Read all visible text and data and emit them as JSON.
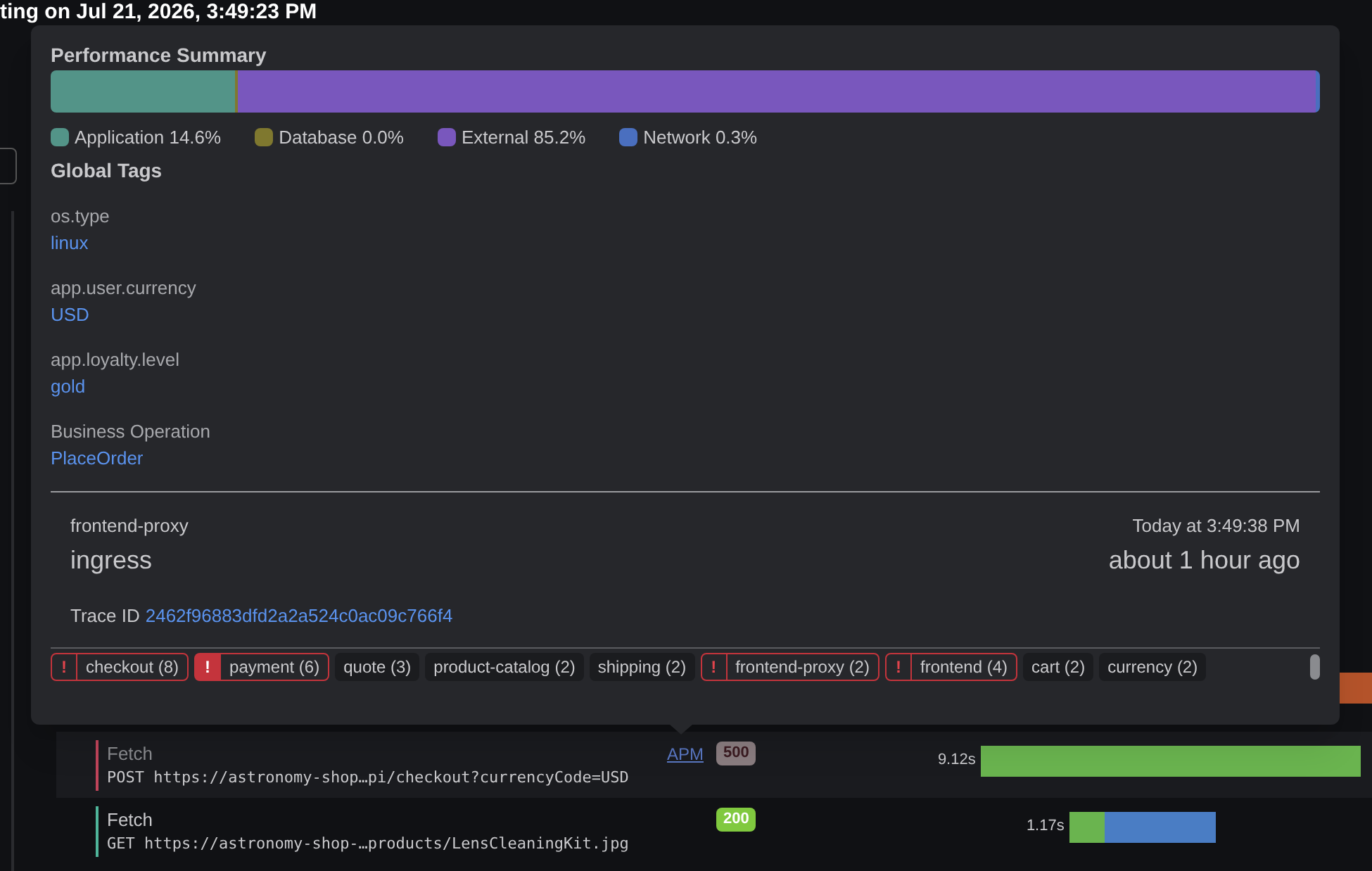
{
  "page_title": "ting on Jul 21, 2026, 3:49:23 PM",
  "popup": {
    "summary_title": "Performance Summary",
    "segments": [
      {
        "label": "Application 14.6%",
        "color": "#539488",
        "level": 0.146
      },
      {
        "label": "Database 0.0%",
        "color": "#7f782f",
        "level": 0.0
      },
      {
        "label": "External 85.2%",
        "color": "#7957bd",
        "level": 0.852
      },
      {
        "label": "Network 0.3%",
        "color": "#4a6fbf",
        "level": 0.003
      }
    ],
    "tags_title": "Global Tags",
    "tags": [
      {
        "key": "os.type",
        "value": "linux"
      },
      {
        "key": "app.user.currency",
        "value": "USD"
      },
      {
        "key": "app.loyalty.level",
        "value": "gold"
      },
      {
        "key": "Business Operation",
        "value": "PlaceOrder"
      }
    ],
    "service": "frontend-proxy",
    "operation": "ingress",
    "time": "Today at 3:49:38 PM",
    "ago": "about 1 hour ago",
    "trace_label": "Trace ID",
    "trace_id": "2462f96883dfd2a2a524c0ac09c766f4",
    "services": [
      {
        "name": "checkout",
        "count": "(8)",
        "kind": "error",
        "icon": "!"
      },
      {
        "name": "payment",
        "count": "(6)",
        "kind": "error_active",
        "icon": "!"
      },
      {
        "name": "quote",
        "count": "(3)",
        "kind": "plain"
      },
      {
        "name": "product-catalog",
        "count": "(2)",
        "kind": "plain"
      },
      {
        "name": "shipping",
        "count": "(2)",
        "kind": "plain"
      },
      {
        "name": "frontend-proxy",
        "count": "(2)",
        "kind": "error",
        "icon": "!"
      },
      {
        "name": "frontend",
        "count": "(4)",
        "kind": "error",
        "icon": "!"
      },
      {
        "name": "cart",
        "count": "(2)",
        "kind": "plain"
      },
      {
        "name": "currency",
        "count": "(2)",
        "kind": "plain"
      }
    ]
  },
  "rows": [
    {
      "title": "Fetch",
      "url": "POST https://astronomy-shop…pi/checkout?currencyCode=USD",
      "link": "APM",
      "status": "500",
      "kind": "error",
      "duration": "9.12s",
      "selected": true
    },
    {
      "title": "Fetch",
      "url": "GET https://astronomy-shop-…products/LensCleaningKit.jpg",
      "status": "200",
      "kind": "ok",
      "duration": "1.17s",
      "selected": false
    }
  ]
}
